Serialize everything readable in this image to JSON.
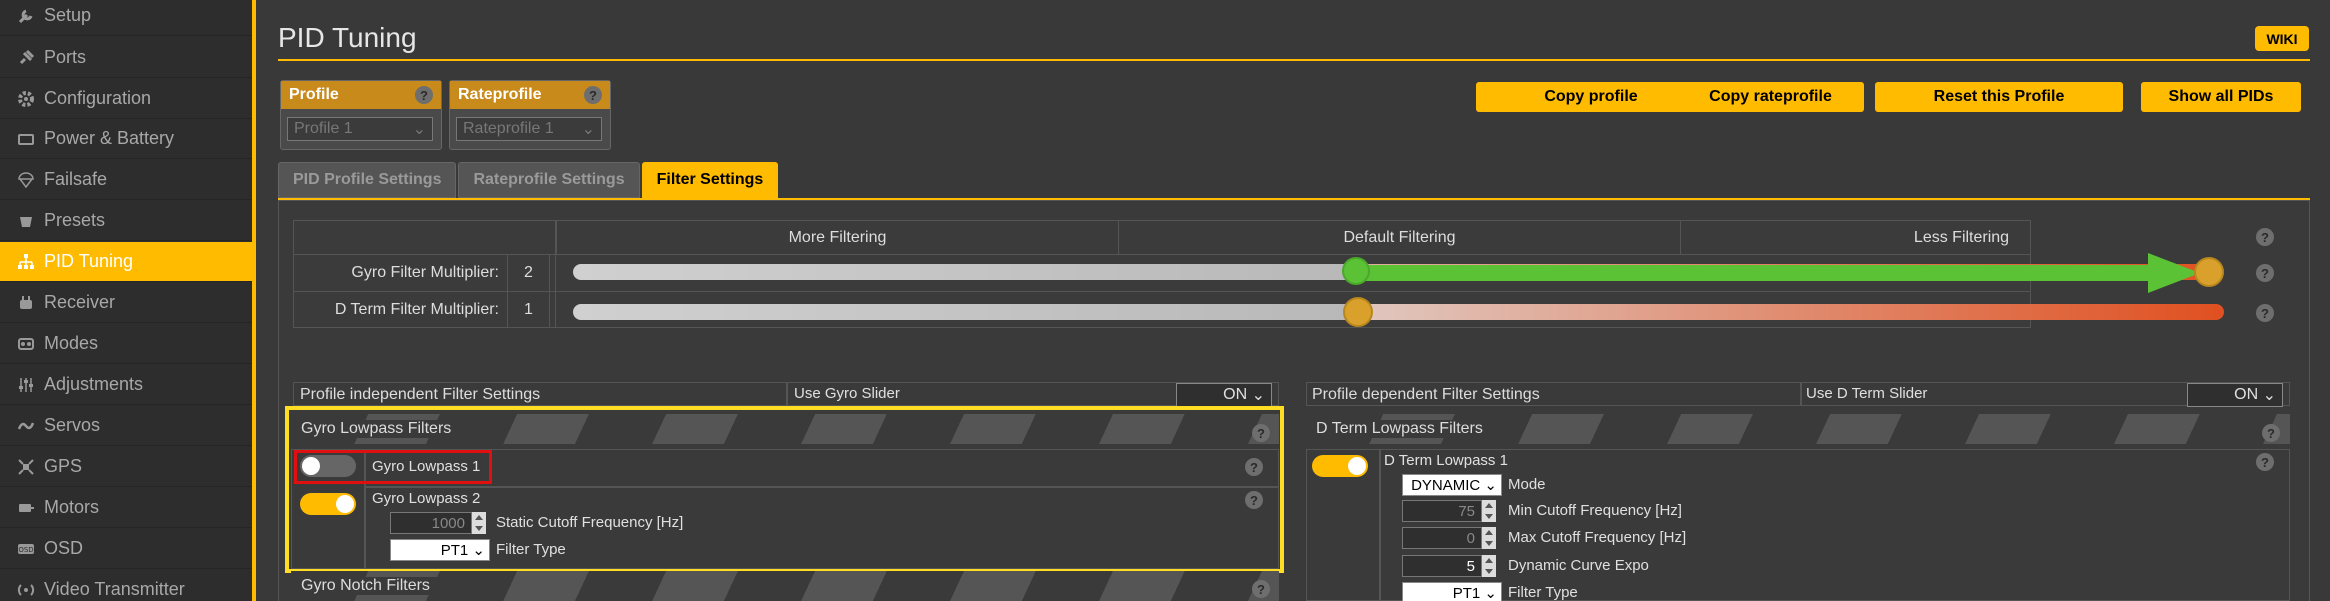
{
  "sidebar": {
    "items": [
      {
        "label": "Setup",
        "icon": "wrench-icon"
      },
      {
        "label": "Ports",
        "icon": "plug-icon"
      },
      {
        "label": "Configuration",
        "icon": "gear-icon"
      },
      {
        "label": "Power & Battery",
        "icon": "battery-icon"
      },
      {
        "label": "Failsafe",
        "icon": "parachute-icon"
      },
      {
        "label": "Presets",
        "icon": "presets-icon"
      },
      {
        "label": "PID Tuning",
        "icon": "pid-tree-icon",
        "active": true
      },
      {
        "label": "Receiver",
        "icon": "receiver-icon"
      },
      {
        "label": "Modes",
        "icon": "modes-icon"
      },
      {
        "label": "Adjustments",
        "icon": "sliders-icon"
      },
      {
        "label": "Servos",
        "icon": "servo-icon"
      },
      {
        "label": "GPS",
        "icon": "gps-icon"
      },
      {
        "label": "Motors",
        "icon": "motor-icon"
      },
      {
        "label": "OSD",
        "icon": "osd-icon"
      },
      {
        "label": "Video Transmitter",
        "icon": "antenna-icon"
      }
    ]
  },
  "header": {
    "title": "PID Tuning",
    "wiki": "WIKI"
  },
  "profile": {
    "label": "Profile",
    "value": "Profile 1",
    "help": "?"
  },
  "rateprofile": {
    "label": "Rateprofile",
    "value": "Rateprofile 1",
    "help": "?"
  },
  "actions": {
    "copy_profile": "Copy profile",
    "copy_rateprofile": "Copy rateprofile",
    "reset_profile": "Reset this Profile",
    "show_all_pids": "Show all PIDs"
  },
  "tabs": [
    "PID Profile Settings",
    "Rateprofile Settings",
    "Filter Settings"
  ],
  "slider_table": {
    "headers": [
      "More Filtering",
      "Default Filtering",
      "Less Filtering"
    ],
    "help": "?",
    "rows": [
      {
        "label": "Gyro Filter Multiplier:",
        "value": "2",
        "level": 1.0
      },
      {
        "label": "D Term Filter Multiplier:",
        "value": "1",
        "level": 0.475
      }
    ]
  },
  "independent": {
    "title": "Profile independent Filter Settings",
    "slider_label": "Use Gyro Slider",
    "slider_value": "ON",
    "lowpass_band": "Gyro Lowpass Filters",
    "lowpass1": {
      "label": "Gyro Lowpass 1",
      "enabled": false
    },
    "lowpass2": {
      "label": "Gyro Lowpass 2",
      "enabled": true,
      "cutoff_value": "1000",
      "cutoff_label": "Static Cutoff Frequency [Hz]",
      "type_value": "PT1",
      "type_label": "Filter Type"
    },
    "notch_band": "Gyro Notch Filters"
  },
  "dependent": {
    "title": "Profile dependent Filter Settings",
    "slider_label": "Use D Term Slider",
    "slider_value": "ON",
    "lowpass_band": "D Term Lowpass Filters",
    "lowpass1": {
      "label": "D Term Lowpass 1",
      "enabled": true,
      "mode_value": "DYNAMIC",
      "mode_label": "Mode",
      "min_value": "75",
      "min_label": "Min Cutoff Frequency [Hz]",
      "max_value": "0",
      "max_label": "Max Cutoff Frequency [Hz]",
      "expo_value": "5",
      "expo_label": "Dynamic Curve Expo",
      "type_value": "PT1",
      "type_label": "Filter Type"
    }
  },
  "colors": {
    "accent": "#ffbb00",
    "slider_green": "#5bc236",
    "slider_red": "#e05020",
    "highlight_yellow": "#ffdd22",
    "highlight_red": "#e01010"
  }
}
